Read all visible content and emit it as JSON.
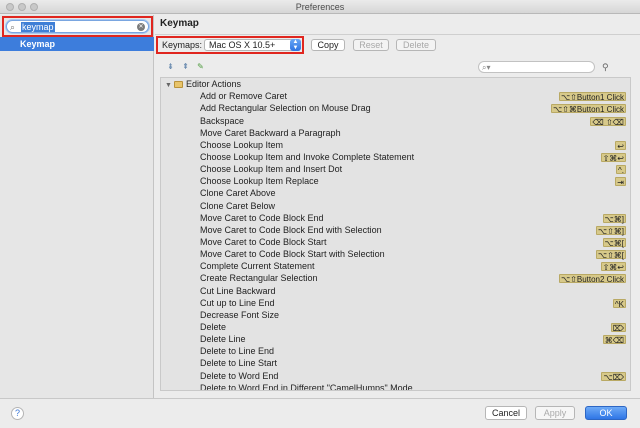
{
  "window": {
    "title": "Preferences"
  },
  "sidebar": {
    "search_value": "keymap",
    "items": [
      {
        "label": "Keymap"
      }
    ]
  },
  "main": {
    "title": "Keymap",
    "keymaps_label": "Keymaps:",
    "keymap_selected": "Mac OS X 10.5+",
    "buttons": {
      "copy": "Copy",
      "reset": "Reset",
      "delete": "Delete"
    },
    "filter_placeholder": ""
  },
  "tree": {
    "group": "Editor Actions",
    "actions": [
      {
        "name": "Add or Remove Caret",
        "shortcut": "⌥⇧Button1 Click"
      },
      {
        "name": "Add Rectangular Selection on Mouse Drag",
        "shortcut": "⌥⇧⌘Button1 Click"
      },
      {
        "name": "Backspace",
        "shortcut": "⌫ ⇧⌫"
      },
      {
        "name": "Move Caret Backward a Paragraph",
        "shortcut": ""
      },
      {
        "name": "Choose Lookup Item",
        "shortcut": "↩"
      },
      {
        "name": "Choose Lookup Item and Invoke Complete Statement",
        "shortcut": "⇧⌘↩"
      },
      {
        "name": "Choose Lookup Item and Insert Dot",
        "shortcut": "^."
      },
      {
        "name": "Choose Lookup Item Replace",
        "shortcut": "⇥"
      },
      {
        "name": "Clone Caret Above",
        "shortcut": ""
      },
      {
        "name": "Clone Caret Below",
        "shortcut": ""
      },
      {
        "name": "Move Caret to Code Block End",
        "shortcut": "⌥⌘]"
      },
      {
        "name": "Move Caret to Code Block End with Selection",
        "shortcut": "⌥⇧⌘]"
      },
      {
        "name": "Move Caret to Code Block Start",
        "shortcut": "⌥⌘["
      },
      {
        "name": "Move Caret to Code Block Start with Selection",
        "shortcut": "⌥⇧⌘["
      },
      {
        "name": "Complete Current Statement",
        "shortcut": "⇧⌘↩"
      },
      {
        "name": "Create Rectangular Selection",
        "shortcut": "⌥⇧Button2 Click"
      },
      {
        "name": "Cut Line Backward",
        "shortcut": ""
      },
      {
        "name": "Cut up to Line End",
        "shortcut": "^K"
      },
      {
        "name": "Decrease Font Size",
        "shortcut": ""
      },
      {
        "name": "Delete",
        "shortcut": "⌦"
      },
      {
        "name": "Delete Line",
        "shortcut": "⌘⌫"
      },
      {
        "name": "Delete to Line End",
        "shortcut": ""
      },
      {
        "name": "Delete to Line Start",
        "shortcut": ""
      },
      {
        "name": "Delete to Word End",
        "shortcut": "⌥⌦"
      },
      {
        "name": "Delete to Word End in Different \"CamelHumps\" Mode",
        "shortcut": ""
      }
    ]
  },
  "footer": {
    "help": "?",
    "cancel": "Cancel",
    "apply": "Apply",
    "ok": "OK"
  },
  "icons": {
    "search": "search-icon",
    "clear": "clear-icon",
    "expand_all": "expand-all-icon",
    "collapse_all": "collapse-all-icon",
    "edit": "edit-icon",
    "find_shortcut": "find-shortcut-icon",
    "folder": "folder-icon"
  },
  "colors": {
    "selection": "#3d7ddc",
    "highlight_outline": "#e0261f",
    "shortcut_bg": "#d7c98a",
    "ok_button": "#2f76e6"
  }
}
